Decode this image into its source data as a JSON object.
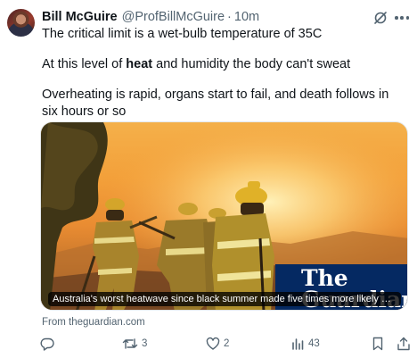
{
  "tweet": {
    "author_name": "Bill McGuire",
    "handle": "@ProfBillMcGuire",
    "separator": "·",
    "time": "10m",
    "line1": "The critical limit is a wet-bulb temperature of 35C",
    "line2_before": "At this level of ",
    "line2_bold": "heat",
    "line2_after": " and humidity the body can't sweat",
    "line3": "Overheating is rapid, organs start to fail, and death follows in six hours or so"
  },
  "card": {
    "headline": "Australia's worst heatwave since black summer made five times more likely by climate crisis",
    "logo_line1": "The",
    "logo_line2": "Guardian",
    "source": "From theguardian.com"
  },
  "actions": {
    "replies": "",
    "reposts": "3",
    "likes": "2",
    "views": "43"
  },
  "colors": {
    "text": "#0f1419",
    "muted": "#536471",
    "guardian_blue": "#052962"
  }
}
